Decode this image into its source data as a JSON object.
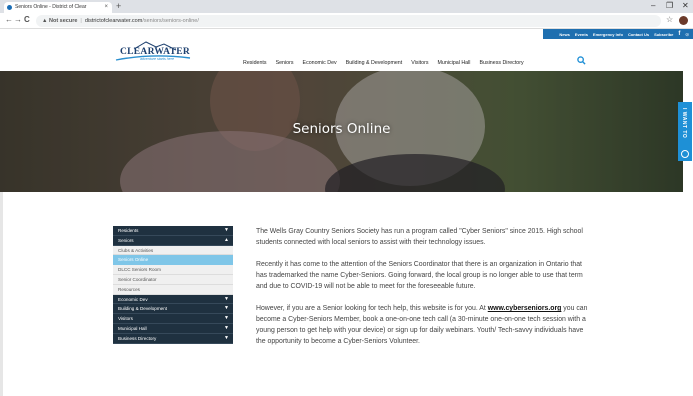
{
  "browser": {
    "tab_title": "Seniors Online - District of Clear",
    "new_tab": "+",
    "url_warning": "Not secure",
    "url_domain": "districtofclearwater.com",
    "url_path": "/seniors/seniors-online/",
    "win_min": "–",
    "win_max": "❐",
    "win_close": "✕",
    "back": "←",
    "forward": "→",
    "reload": "C"
  },
  "utility_nav": [
    "News",
    "Events",
    "Emergency Info",
    "Contact Us",
    "Subscribe",
    "f",
    "☉"
  ],
  "logo": {
    "name": "CLEARWATER",
    "tagline": "adventure starts here"
  },
  "main_nav": [
    "Residents",
    "Seniors",
    "Economic Dev",
    "Building & Development",
    "Visitors",
    "Municipal Hall",
    "Business Directory"
  ],
  "hero": {
    "title": "Seniors Online"
  },
  "i_want_to": "I WANT TO",
  "sidebar": [
    {
      "label": "Residents",
      "kind": "dark",
      "caret": "▼"
    },
    {
      "label": "Seniors",
      "kind": "dark",
      "caret": "▲"
    },
    {
      "label": "Clubs & Activities",
      "kind": "sub",
      "caret": ""
    },
    {
      "label": "Seniors Online",
      "kind": "active",
      "caret": ""
    },
    {
      "label": "DLCC Seniors Room",
      "kind": "sub",
      "caret": ""
    },
    {
      "label": "Senior Coordinator",
      "kind": "sub",
      "caret": ""
    },
    {
      "label": "Resources",
      "kind": "sub",
      "caret": ""
    },
    {
      "label": "Economic Dev",
      "kind": "dark",
      "caret": "▼"
    },
    {
      "label": "Building & Development",
      "kind": "dark",
      "caret": "▼"
    },
    {
      "label": "Visitors",
      "kind": "dark",
      "caret": "▼"
    },
    {
      "label": "Municipal Hall",
      "kind": "dark",
      "caret": "▼"
    },
    {
      "label": "Business Directory",
      "kind": "dark",
      "caret": "▼"
    }
  ],
  "content": {
    "p1": "The Wells Gray Country Seniors Society has run a program called \"Cyber Seniors\" since 2015. High school students connected with local seniors to assist with their technology issues.",
    "p2": "Recently it has come to the attention of the Seniors Coordinator that there is an organization in Ontario that has trademarked the name Cyber-Seniors. Going forward, the local group is no longer able to use that term and due to COVID-19 will not be able to meet for the foreseeable future.",
    "p3_before": "However, if you are a Senior looking for tech help, this website is for you. At ",
    "p3_link": "www.cyberseniors.org",
    "p3_after": " you can become a Cyber-Seniors Member, book a one-on-one tech call (a 30-minute one-on-one tech session with a young person to get help with your device) or sign up for daily webinars. Youth/ Tech-savvy individuals have the opportunity to become a Cyber-Seniors Volunteer."
  },
  "colors": {
    "navy": "#1f3140",
    "active": "#7fc6e8",
    "util_blue": "#1e6fb0",
    "iwant_blue": "#1e90d6"
  }
}
